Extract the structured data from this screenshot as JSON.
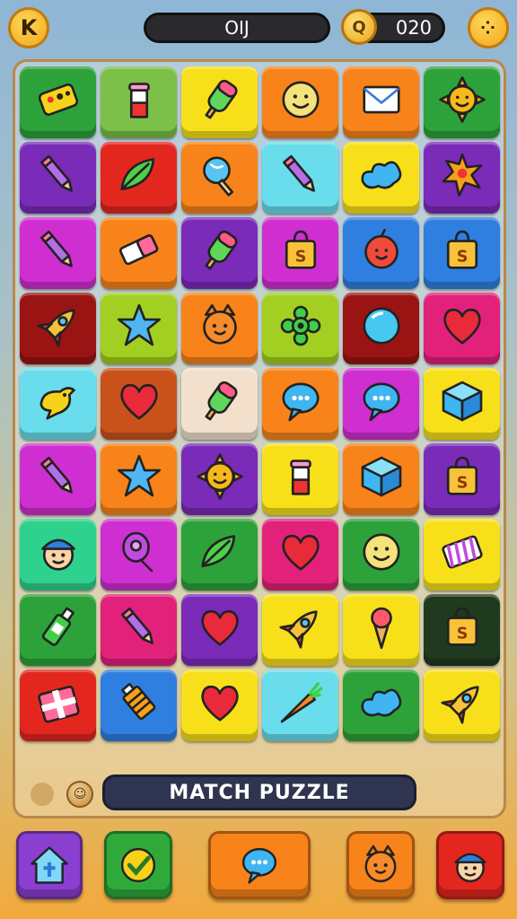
{
  "header": {
    "back_label": "K",
    "menu_label": "⁘",
    "title": "OIJ",
    "coin_symbol": "Q",
    "coins": "020"
  },
  "footer": {
    "label": "MATCH PUZZLE",
    "small_icon": "☺"
  },
  "colors": {
    "green": "#2ea23a",
    "olive": "#7cc04a",
    "yellow": "#f7e01a",
    "orange": "#f7831a",
    "purple": "#7a2bb8",
    "red": "#e3271f",
    "cyan": "#69ddeb",
    "blue": "#2f7fe0",
    "magenta": "#cf2fd0",
    "pink": "#e2217a",
    "darkred": "#9a1414",
    "lime": "#a3cf22",
    "brown": "#c9521b",
    "cream": "#f3e0cc",
    "teal": "#2fd18e",
    "darkgreen": "#1f3a1e"
  },
  "grid": [
    [
      {
        "bg": "green",
        "icon": "toy-block-icon"
      },
      {
        "bg": "olive",
        "icon": "cup-icon"
      },
      {
        "bg": "yellow",
        "icon": "popsicle-icon"
      },
      {
        "bg": "orange",
        "icon": "smiley-face-icon"
      },
      {
        "bg": "orange",
        "icon": "envelope-icon"
      },
      {
        "bg": "green",
        "icon": "sun-face-icon"
      }
    ],
    [
      {
        "bg": "purple",
        "icon": "pencil-icon"
      },
      {
        "bg": "red",
        "icon": "leaf-icon"
      },
      {
        "bg": "orange",
        "icon": "lollipop-icon"
      },
      {
        "bg": "cyan",
        "icon": "pencil-icon"
      },
      {
        "bg": "yellow",
        "icon": "splash-icon"
      },
      {
        "bg": "purple",
        "icon": "burst-star-icon"
      }
    ],
    [
      {
        "bg": "magenta",
        "icon": "pencil-icon"
      },
      {
        "bg": "orange",
        "icon": "eraser-icon"
      },
      {
        "bg": "purple",
        "icon": "popsicle-icon"
      },
      {
        "bg": "magenta",
        "icon": "shopping-bag-icon"
      },
      {
        "bg": "blue",
        "icon": "apple-face-icon"
      },
      {
        "bg": "blue",
        "icon": "shopping-bag-icon"
      }
    ],
    [
      {
        "bg": "darkred",
        "icon": "rocket-icon"
      },
      {
        "bg": "lime",
        "icon": "star-icon"
      },
      {
        "bg": "orange",
        "icon": "cat-face-icon"
      },
      {
        "bg": "lime",
        "icon": "flower-icon"
      },
      {
        "bg": "darkred",
        "icon": "ball-icon"
      },
      {
        "bg": "pink",
        "icon": "heart-icon"
      }
    ],
    [
      {
        "bg": "cyan",
        "icon": "bird-icon"
      },
      {
        "bg": "brown",
        "icon": "heart-icon"
      },
      {
        "bg": "cream",
        "icon": "popsicle-icon"
      },
      {
        "bg": "orange",
        "icon": "speech-bubble-icon"
      },
      {
        "bg": "magenta",
        "icon": "speech-bubble-icon"
      },
      {
        "bg": "yellow",
        "icon": "cube-icon"
      }
    ],
    [
      {
        "bg": "magenta",
        "icon": "pencil-icon"
      },
      {
        "bg": "orange",
        "icon": "star-icon"
      },
      {
        "bg": "purple",
        "icon": "sun-face-icon"
      },
      {
        "bg": "yellow",
        "icon": "cup-icon"
      },
      {
        "bg": "orange",
        "icon": "cube-icon"
      },
      {
        "bg": "purple",
        "icon": "shopping-bag-icon"
      }
    ],
    [
      {
        "bg": "teal",
        "icon": "boy-face-icon"
      },
      {
        "bg": "magenta",
        "icon": "balloon-icon"
      },
      {
        "bg": "green",
        "icon": "leaf-icon"
      },
      {
        "bg": "pink",
        "icon": "heart-icon"
      },
      {
        "bg": "green",
        "icon": "smiley-face-icon"
      },
      {
        "bg": "yellow",
        "icon": "candy-box-icon"
      }
    ],
    [
      {
        "bg": "green",
        "icon": "glue-bottle-icon"
      },
      {
        "bg": "pink",
        "icon": "pencil-icon"
      },
      {
        "bg": "purple",
        "icon": "heart-icon"
      },
      {
        "bg": "yellow",
        "icon": "rocket-icon"
      },
      {
        "bg": "yellow",
        "icon": "ice-cream-cone-icon"
      },
      {
        "bg": "darkgreen",
        "icon": "shopping-bag-icon"
      }
    ],
    [
      {
        "bg": "red",
        "icon": "gift-icon"
      },
      {
        "bg": "blue",
        "icon": "paint-tube-icon"
      },
      {
        "bg": "yellow",
        "icon": "heart-icon"
      },
      {
        "bg": "cyan",
        "icon": "carrot-icon"
      },
      {
        "bg": "green",
        "icon": "splash-icon"
      },
      {
        "bg": "yellow",
        "icon": "rocket-icon"
      }
    ]
  ],
  "actions": [
    {
      "name": "home-action-button",
      "icon": "house-icon",
      "bg": "#8a3fd0"
    },
    {
      "name": "check-action-button",
      "icon": "check-badge-icon",
      "bg": "#2faa3a"
    },
    {
      "name": "chat-action-button",
      "icon": "speech-bubble-icon",
      "bg": "#f7831a"
    },
    {
      "name": "character-action-button",
      "icon": "cat-face-icon",
      "bg": "#f7831a"
    },
    {
      "name": "profile-action-button",
      "icon": "boy-face-icon",
      "bg": "#e3271f"
    }
  ]
}
